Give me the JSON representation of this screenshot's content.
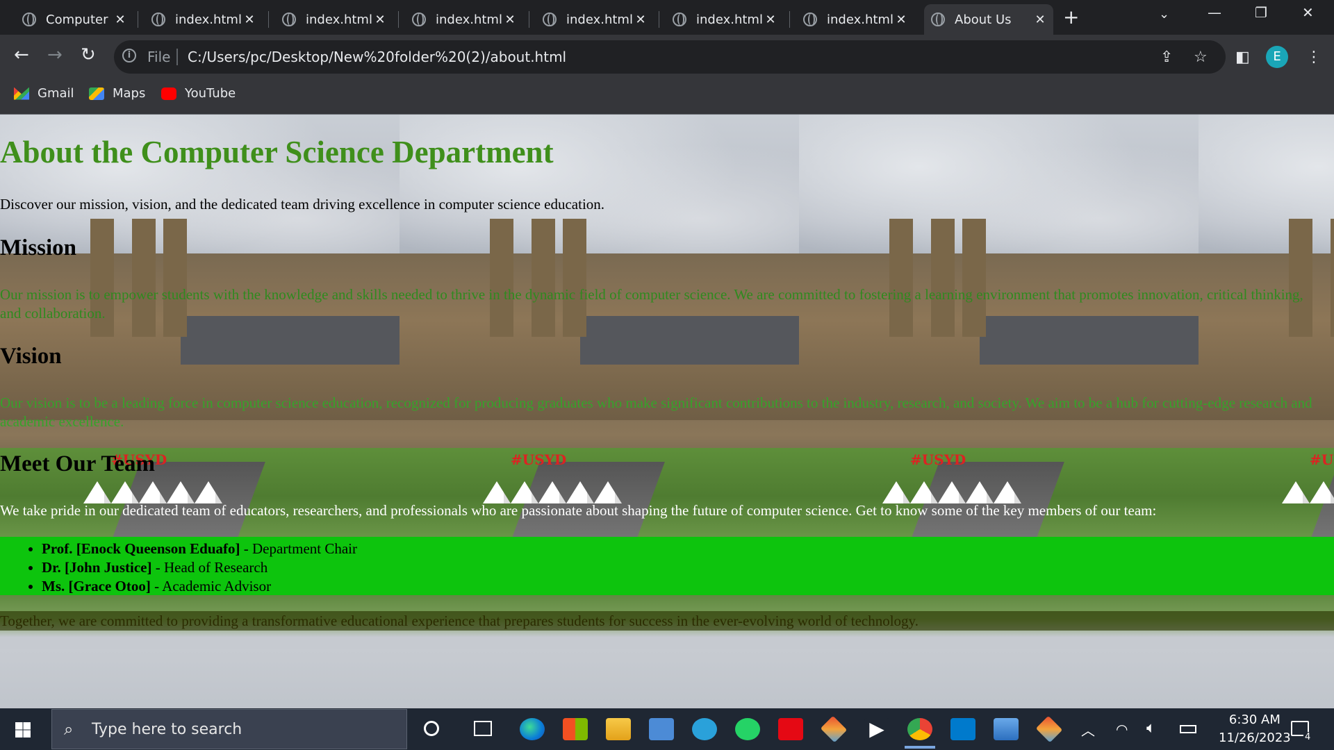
{
  "browser": {
    "tabs": [
      {
        "title": "Computer"
      },
      {
        "title": "index.html"
      },
      {
        "title": "index.html"
      },
      {
        "title": "index.html"
      },
      {
        "title": "index.html"
      },
      {
        "title": "index.html"
      },
      {
        "title": "index.html"
      },
      {
        "title": "About Us",
        "active": true
      }
    ],
    "address": {
      "scheme": "File",
      "url": "C:/Users/pc/Desktop/New%20folder%20(2)/about.html"
    },
    "profile_initial": "E",
    "bookmarks": [
      {
        "label": "Gmail",
        "icon": "gmail-icon"
      },
      {
        "label": "Maps",
        "icon": "maps-icon"
      },
      {
        "label": "YouTube",
        "icon": "youtube-icon"
      }
    ]
  },
  "page": {
    "title": "About the Computer Science Department",
    "intro": "Discover our mission, vision, and the dedicated team driving excellence in computer science education.",
    "mission_heading": "Mission",
    "mission_text": "Our mission is to empower students with the knowledge and skills needed to thrive in the dynamic field of computer science. We are committed to fostering a learning environment that promotes innovation, critical thinking, and collaboration.",
    "vision_heading": "Vision",
    "vision_text": "Our vision is to be a leading force in computer science education, recognized for producing graduates who make significant contributions to the industry, research, and society. We aim to be a hub for cutting-edge research and academic excellence.",
    "team_heading": "Meet Our Team",
    "team_intro": "We take pride in our dedicated team of educators, researchers, and professionals who are passionate about shaping the future of computer science. Get to know some of the key members of our team:",
    "team": [
      {
        "name": "Prof. [Enock Queenson Eduafo]",
        "role": " - Department Chair"
      },
      {
        "name": "Dr. [John Justice]",
        "role": " - Head of Research"
      },
      {
        "name": "Ms. [Grace Otoo]",
        "role": " - Academic Advisor"
      }
    ],
    "closing": "Together, we are committed to providing a transformative educational experience that prepares students for success in the ever-evolving world of technology.",
    "background_sign": "#USYD"
  },
  "taskbar": {
    "search_placeholder": "Type here to search",
    "time": "6:30 AM",
    "date": "11/26/2023",
    "notification_count": "4"
  },
  "colors": {
    "heading_green": "#3f8f1b",
    "team_band": "#0dc40d",
    "mission_text": "#2f8a1f",
    "vision_text": "#36a32a"
  }
}
